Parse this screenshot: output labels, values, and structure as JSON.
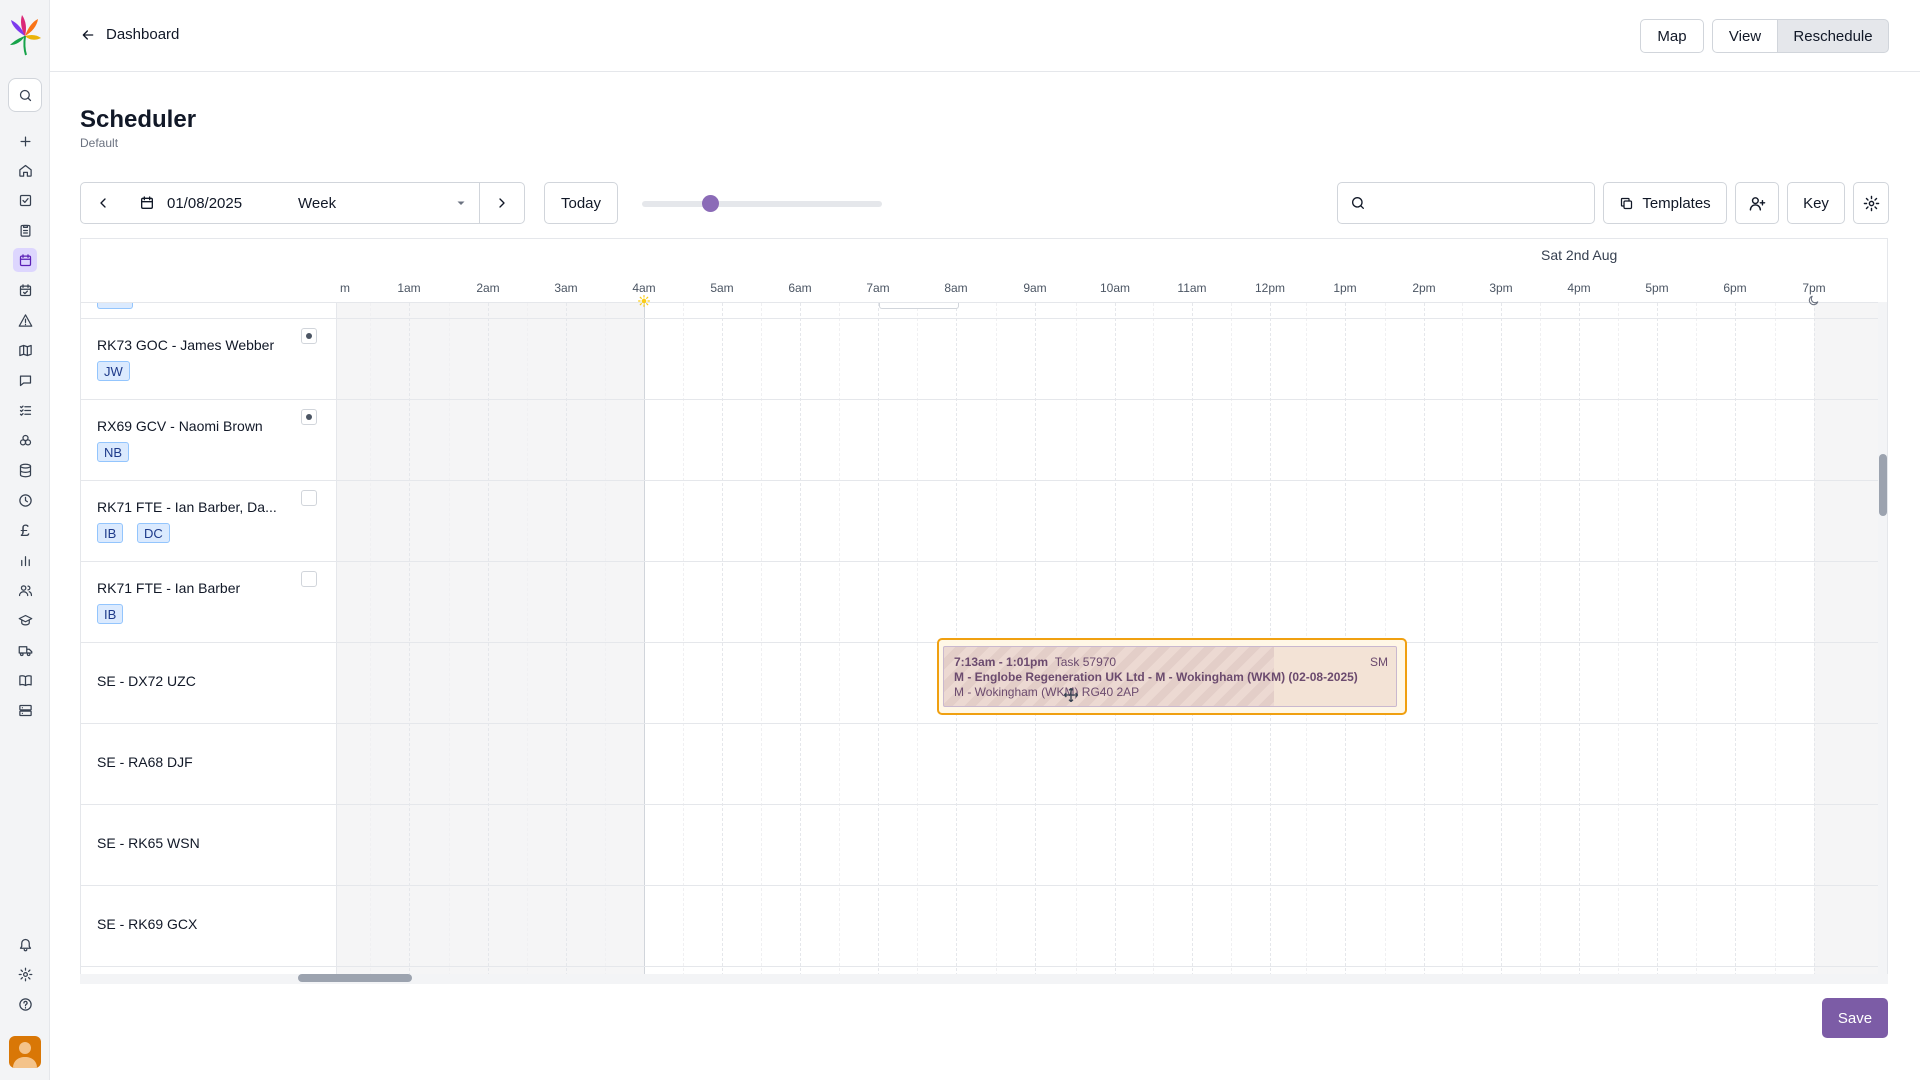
{
  "header": {
    "back_label": "Dashboard",
    "buttons": {
      "map": "Map",
      "view": "View",
      "reschedule": "Reschedule"
    }
  },
  "page": {
    "title": "Scheduler",
    "subtitle": "Default"
  },
  "toolbar": {
    "date": "01/08/2025",
    "range": "Week",
    "today": "Today",
    "search_placeholder": "",
    "templates": "Templates",
    "key": "Key"
  },
  "grid": {
    "day_label": "Sat 2nd Aug",
    "hours": [
      "m",
      "1am",
      "2am",
      "3am",
      "4am",
      "5am",
      "6am",
      "7am",
      "8am",
      "9am",
      "10am",
      "11am",
      "12pm",
      "1pm",
      "2pm",
      "3pm",
      "4pm",
      "5pm",
      "6pm",
      "7pm"
    ],
    "rows": [
      {
        "name": "RK73 GOC - James Webber",
        "chips": [
          "JW"
        ],
        "checked": true
      },
      {
        "name": "RX69 GCV - Naomi Brown",
        "chips": [
          "NB"
        ],
        "checked": true
      },
      {
        "name": "RK71 FTE - Ian Barber, Da...",
        "chips": [
          "IB",
          "DC"
        ],
        "checked": false
      },
      {
        "name": "RK71 FTE - Ian Barber",
        "chips": [
          "IB"
        ],
        "checked": false
      },
      {
        "name": "SE - DX72 UZC",
        "chips": []
      },
      {
        "name": "SE - RA68 DJF",
        "chips": []
      },
      {
        "name": "SE - RK65 WSN",
        "chips": []
      },
      {
        "name": "SE - RK69 GCX",
        "chips": []
      }
    ],
    "task": {
      "time": "7:13am - 1:01pm",
      "task_id": "Task 57970",
      "initials": "SM",
      "line2": "M - Englobe Regeneration UK Ltd - M - Wokingham (WKM) (02-08-2025)",
      "line3": "M - Wokingham (WKM) RG40 2AP"
    }
  },
  "footer": {
    "save": "Save"
  },
  "colors": {
    "accent": "#7c5ca6",
    "task_border": "#f0a010",
    "chip_bg": "#dbeafe"
  }
}
